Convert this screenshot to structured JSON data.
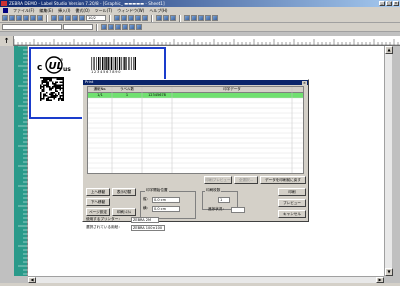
{
  "titlebar": {
    "title": "ZEBRA DEMO - Label Studio Version 7.20/8 - [Graphic_ ▬▬▬▬▬ - Sheet1]",
    "buttons": [
      "_",
      "□",
      "×"
    ]
  },
  "menubar": {
    "items": [
      "ファイル(F)",
      "編集(E)",
      "挿入(I)",
      "書式(O)",
      "ツール(T)",
      "ウィンドウ(W)",
      "ヘルプ(H)"
    ]
  },
  "toolbar": {
    "font_size": "10/2",
    "ruler_icon": "↑"
  },
  "label": {
    "barcode_text": "1234567890",
    "ul_mark": "c UL us",
    "ul_r": "®"
  },
  "dialog": {
    "title": "Print",
    "close": "×",
    "grid": {
      "headers": [
        "通紙No.",
        "ラベル数",
        "",
        "印字データ"
      ],
      "rows": [
        [
          "1/1",
          "1",
          "12345678",
          ""
        ]
      ]
    },
    "buttons": {
      "move_up": "上へ移動",
      "display_toggle": "表示切替",
      "move_down": "下へ移動",
      "page_setup": "ページ設定",
      "print_setup": "印刷ｼｽﾃﾑ",
      "disabled_1": "印刷プレビュー",
      "disabled_2": "全選択…",
      "data_reload": "データを印刷前に戻す",
      "print": "印刷",
      "preview": "プレビュー",
      "cancel": "キャンセル"
    },
    "position_group": "印字開始位置",
    "vertical_label": "縦：",
    "vertical_value": "0.0 cm",
    "horizontal_label": "横：",
    "horizontal_value": "0.0 cm",
    "copies_group": "印刷枚数",
    "copies_value": "1",
    "printer_label": "使用するプリンター：",
    "printer_value": "ZEBRA 2M",
    "media_label": "選択されている用紙：",
    "media_value": "ZEBRA 100×100",
    "progress_label": "進捗状況："
  }
}
